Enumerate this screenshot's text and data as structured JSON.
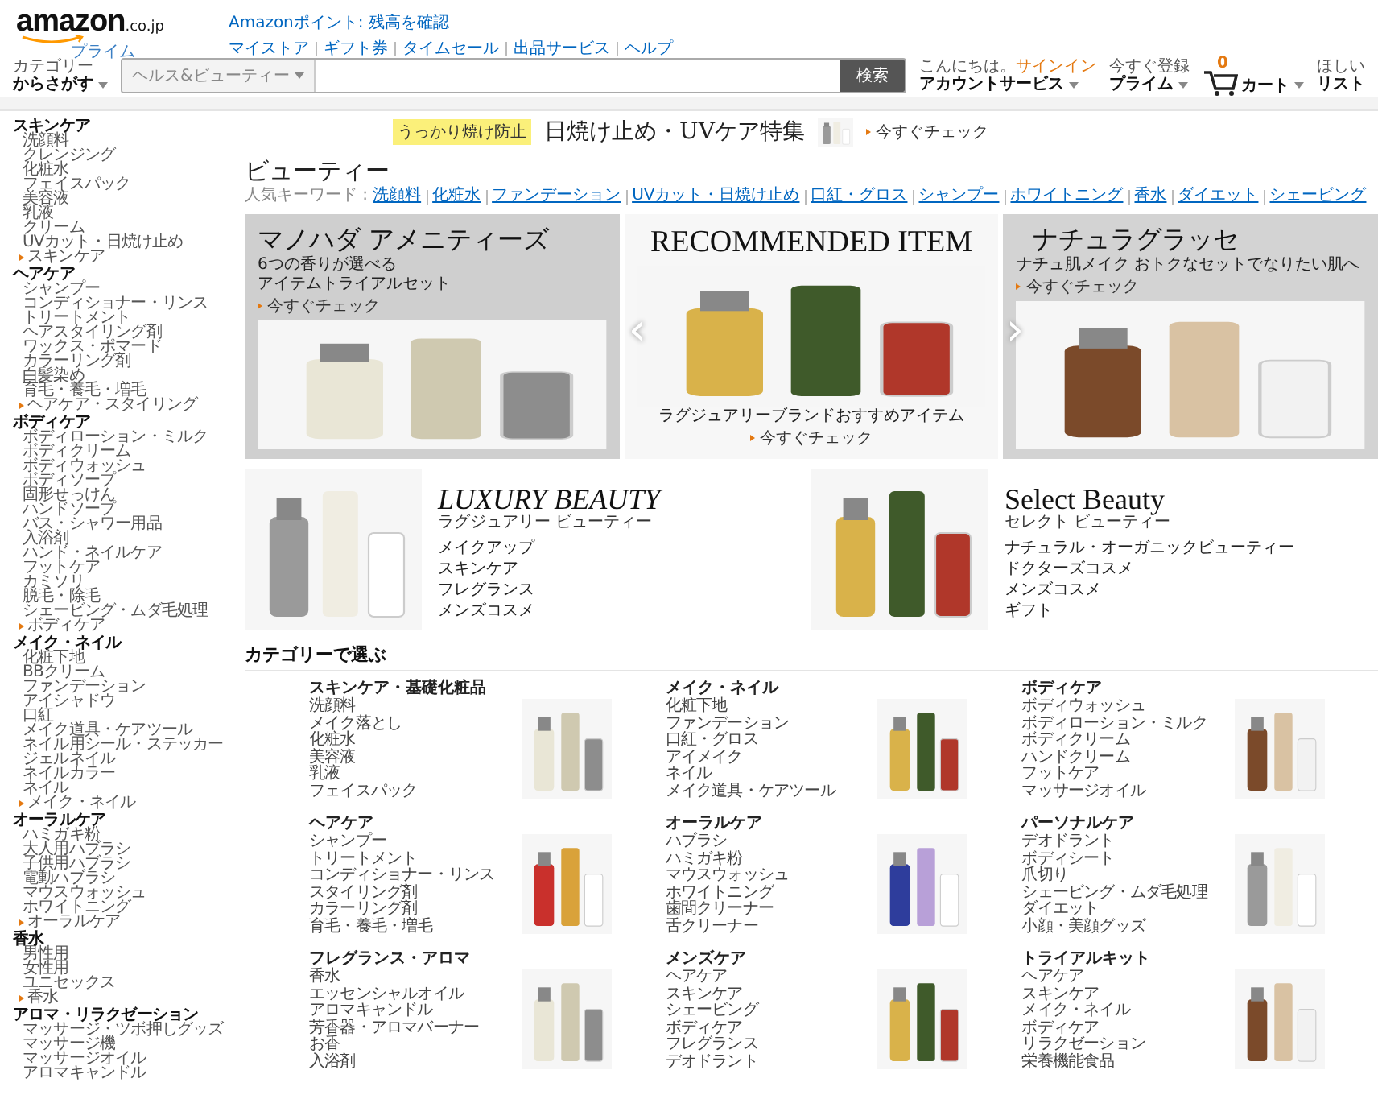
{
  "header": {
    "logo": {
      "wordmark": "amazon",
      "domain": ".co.jp",
      "tagline": "プライム"
    },
    "points_link": "Amazonポイント: 残高を確認",
    "nav_links": [
      "マイストア",
      "ギフト券",
      "タイムセール",
      "出品サービス",
      "ヘルプ"
    ],
    "category_menu": {
      "top": "カテゴリー",
      "label": "からさがす"
    },
    "search": {
      "scope": "ヘルス&ビューティー",
      "button": "検索"
    },
    "account_menus": [
      {
        "top": "こんにちは。",
        "link": "サインイン",
        "label": "アカウントサービス"
      },
      {
        "top": "今すぐ登録",
        "label": "プライム"
      }
    ],
    "cart": {
      "count": "0",
      "label": "カート"
    },
    "wishlist": {
      "top": "ほしい",
      "label": "リスト"
    }
  },
  "sidebar": [
    {
      "title": "スキンケア",
      "items": [
        "洗顔料",
        "クレンジング",
        "化粧水",
        "フェイスパック",
        "美容液",
        "乳液",
        "クリーム",
        "UVカット・日焼け止め"
      ],
      "more": "スキンケア"
    },
    {
      "title": "ヘアケア",
      "items": [
        "シャンプー",
        "コンディショナー・リンス",
        "トリートメント",
        "ヘアスタイリング剤",
        "ワックス・ポマード",
        "カラーリング剤",
        "白髪染め",
        "育毛・養毛・増毛"
      ],
      "more": "ヘアケア・スタイリング"
    },
    {
      "title": "ボディケア",
      "items": [
        "ボディローション・ミルク",
        "ボディクリーム",
        "ボディウォッシュ",
        "ボディソープ",
        "固形せっけん",
        "ハンドソープ",
        "バス・シャワー用品",
        "入浴剤",
        "ハンド・ネイルケア",
        "フットケア",
        "カミソリ",
        "脱毛・除毛",
        "シェービング・ムダ毛処理"
      ],
      "more": "ボディケア"
    },
    {
      "title": "メイク・ネイル",
      "items": [
        "化粧下地",
        "BBクリーム",
        "ファンデーション",
        "アイシャドウ",
        "口紅",
        "メイク道具・ケアツール",
        "ネイル用シール・ステッカー",
        "ジェルネイル",
        "ネイルカラー",
        "ネイル"
      ],
      "more": "メイク・ネイル"
    },
    {
      "title": "オーラルケア",
      "items": [
        "ハミガキ粉",
        "大人用ハブラシ",
        "子供用ハブラシ",
        "電動ハブラシ",
        "マウスウォッシュ",
        "ホワイトニング"
      ],
      "more": "オーラルケア"
    },
    {
      "title": "香水",
      "items": [
        "男性用",
        "女性用",
        "ユニセックス"
      ],
      "more": "香水"
    },
    {
      "title": "アロマ・リラクゼーション",
      "items": [
        "マッサージ・ツボ押しグッズ",
        "マッサージ機",
        "マッサージオイル",
        "アロマキャンドル"
      ]
    }
  ],
  "promo": {
    "highlight": "うっかり焼け防止",
    "title": "日焼け止め・UVケア特集",
    "link": "今すぐチェック"
  },
  "page_title": "ビューティー",
  "keywords": {
    "label": "人気キーワード :",
    "items": [
      "洗顔料",
      "化粧水",
      "ファンデーション",
      "UVカット・日焼け止め",
      "口紅・グロス",
      "シャンプー",
      "ホワイトニング",
      "香水",
      "ダイエット",
      "シェービング"
    ]
  },
  "carousel": {
    "prev": "‹",
    "next": "›",
    "slides": [
      {
        "kind": "amenity",
        "title": "マノハダ アメニティーズ",
        "lines": [
          "6つの香りが選べる",
          "アイテムトライアルセット"
        ],
        "link": "今すぐチェック"
      },
      {
        "kind": "recommended",
        "title": "RECOMMENDED ITEM",
        "lines": [
          "ラグジュアリーブランドおすすめアイテム"
        ],
        "link": "今すぐチェック"
      },
      {
        "kind": "cosmetic",
        "title": "ナチュラグラッセ",
        "lines": [
          "ナチュ肌メイク おトクなセットでなりたい肌へ"
        ],
        "link": "今すぐチェック"
      }
    ]
  },
  "featured": [
    {
      "kind": "luxury",
      "title": "LUXURY BEAUTY",
      "subtitle": "ラグジュアリー ビューティー",
      "links": [
        "メイクアップ",
        "スキンケア",
        "フレグランス",
        "メンズコスメ"
      ]
    },
    {
      "kind": "select",
      "title": "Select Beauty",
      "subtitle": "セレクト ビューティー",
      "links": [
        "ナチュラル・オーガニックビューティー",
        "ドクターズコスメ",
        "メンズコスメ",
        "ギフト"
      ]
    }
  ],
  "categories_heading": "カテゴリーで選ぶ",
  "categories": [
    {
      "title": "スキンケア・基礎化粧品",
      "items": [
        "洗顔料",
        "メイク落とし",
        "化粧水",
        "美容液",
        "乳液",
        "フェイスパック"
      ]
    },
    {
      "title": "メイク・ネイル",
      "items": [
        "化粧下地",
        "ファンデーション",
        "口紅・グロス",
        "アイメイク",
        "ネイル",
        "メイク道具・ケアツール"
      ]
    },
    {
      "title": "ボディケア",
      "items": [
        "ボディウォッシュ",
        "ボディローション・ミルク",
        "ボディクリーム",
        "ハンドクリーム",
        "フットケア",
        "マッサージオイル"
      ]
    },
    {
      "title": "ヘアケア",
      "items": [
        "シャンプー",
        "トリートメント",
        "コンディショナー・リンス",
        "スタイリング剤",
        "カラーリング剤",
        "育毛・養毛・増毛"
      ]
    },
    {
      "title": "オーラルケア",
      "items": [
        "ハブラシ",
        "ハミガキ粉",
        "マウスウォッシュ",
        "ホワイトニング",
        "歯間クリーナー",
        "舌クリーナー"
      ]
    },
    {
      "title": "パーソナルケア",
      "items": [
        "デオドラント",
        "ボディシート",
        "爪切り",
        "シェービング・ムダ毛処理",
        "ダイエット",
        "小顔・美顔グッズ"
      ]
    },
    {
      "title": "フレグランス・アロマ",
      "items": [
        "香水",
        "エッセンシャルオイル",
        "アロマキャンドル",
        "芳香器・アロマバーナー",
        "お香",
        "入浴剤"
      ]
    },
    {
      "title": "メンズケア",
      "items": [
        "ヘアケア",
        "スキンケア",
        "シェービング",
        "ボディケア",
        "フレグランス",
        "デオドラント"
      ]
    },
    {
      "title": "トライアルキット",
      "items": [
        "ヘアケア",
        "スキンケア",
        "メイク・ネイル",
        "ボディケア",
        "リラクゼーション",
        "栄養機能食品"
      ]
    }
  ]
}
